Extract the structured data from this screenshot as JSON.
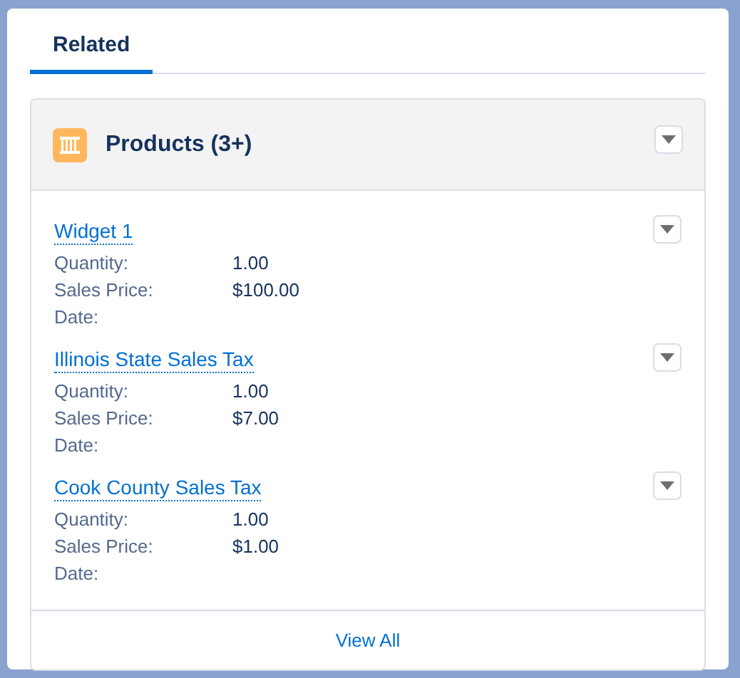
{
  "tabs": [
    {
      "label": "Related",
      "selected": true
    }
  ],
  "card": {
    "title": "Products (3+)",
    "items": [
      {
        "name": "Widget 1",
        "fields": [
          {
            "label": "Quantity:",
            "value": "1.00"
          },
          {
            "label": "Sales Price:",
            "value": "$100.00"
          },
          {
            "label": "Date:"
          }
        ]
      },
      {
        "name": "Illinois State Sales Tax",
        "fields": [
          {
            "label": "Quantity:",
            "value": "1.00"
          },
          {
            "label": "Sales Price:",
            "value": "$7.00"
          },
          {
            "label": "Date:"
          }
        ]
      },
      {
        "name": "Cook County Sales Tax",
        "fields": [
          {
            "label": "Quantity:",
            "value": "1.00"
          },
          {
            "label": "Sales Price:",
            "value": "$1.00"
          },
          {
            "label": "Date:"
          }
        ]
      }
    ],
    "footer_link": "View All"
  }
}
